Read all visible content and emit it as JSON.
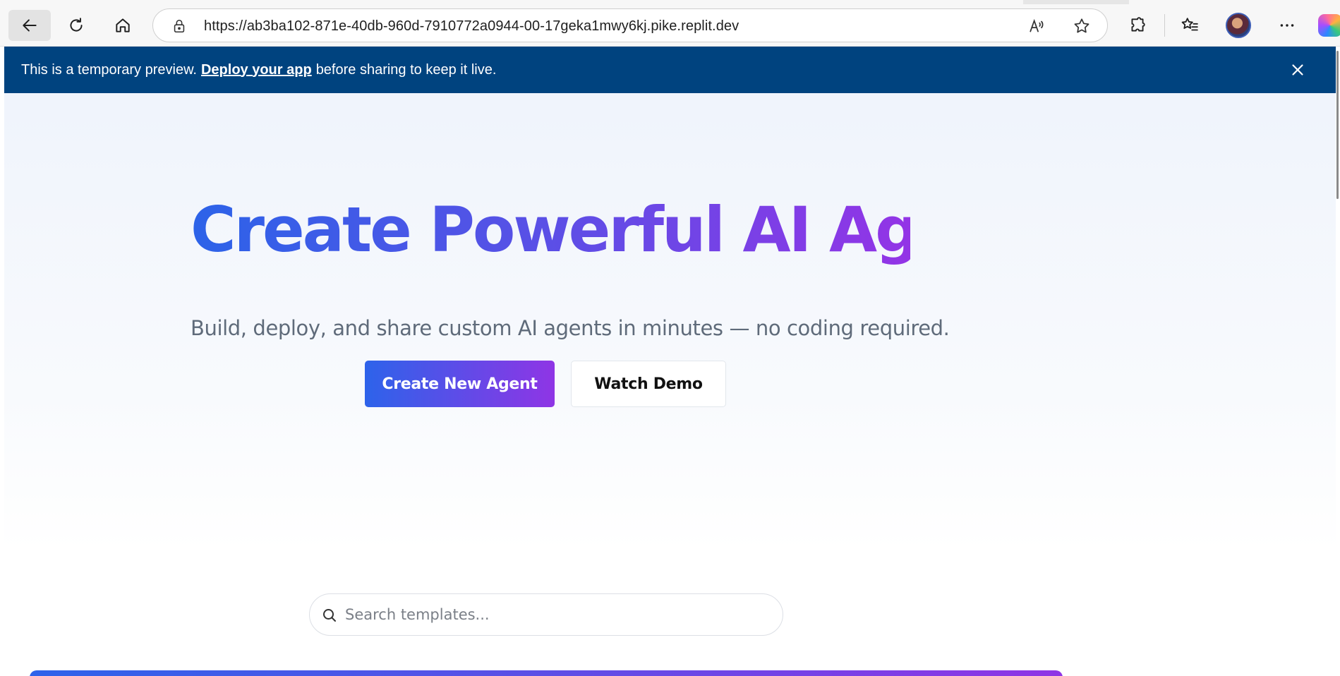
{
  "browser": {
    "url": "https://ab3ba102-871e-40db-960d-7910772a0944-00-17geka1mwy6kj.pike.replit.dev",
    "icons": [
      "back-arrow-icon",
      "refresh-icon",
      "home-icon",
      "lock-icon",
      "read-aloud-icon",
      "favorite-star-icon",
      "extensions-icon",
      "favorites-icon",
      "profile-avatar",
      "more-icon",
      "copilot-icon"
    ]
  },
  "banner": {
    "text_before": "This is a temporary preview.",
    "link": "Deploy your app",
    "text_after": "before sharing to keep it live."
  },
  "hero": {
    "title": "Create Powerful AI Agents",
    "subtitle": "Build, deploy, and share custom AI agents in minutes — no coding required.",
    "primary_button": "Create New Agent",
    "secondary_button": "Watch Demo"
  },
  "search": {
    "placeholder": "Search templates..."
  },
  "colors": {
    "banner_bg": "#00437f",
    "gradient_start": "#2c63e8",
    "gradient_end": "#9334e6"
  }
}
